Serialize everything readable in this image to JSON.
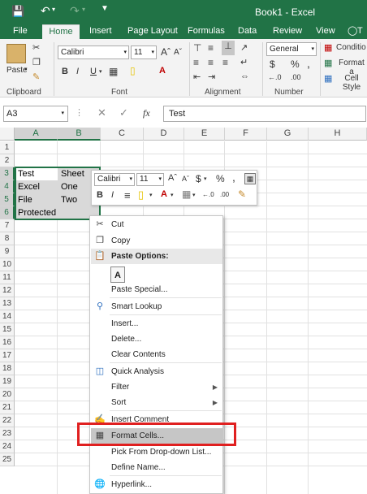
{
  "title_bar": {
    "title": "Book1 - Excel",
    "tell_me_partial": "T"
  },
  "ribbon_tabs": [
    "File",
    "Home",
    "Insert",
    "Page Layout",
    "Formulas",
    "Data",
    "Review",
    "View"
  ],
  "ribbon": {
    "paste_label": "Paste",
    "font_name": "Calibri",
    "font_size": "11",
    "number_format": "General",
    "bold": "B",
    "italic": "I",
    "underline": "U",
    "currency": "$",
    "percent": "%",
    "comma": ",",
    "conditional_formatting": "Conditio",
    "format_as_table": "Format a",
    "cell_styles": "Cell Style",
    "groups": {
      "clipboard": "Clipboard",
      "font": "Font",
      "alignment": "Alignment",
      "number": "Number"
    }
  },
  "formula_bar": {
    "name_box": "A3",
    "fx": "fx",
    "content": "Test"
  },
  "columns": [
    "A",
    "B",
    "C",
    "D",
    "E",
    "F",
    "G",
    "H"
  ],
  "rows": [
    "1",
    "2",
    "3",
    "4",
    "5",
    "6",
    "7",
    "8",
    "9",
    "10",
    "11",
    "12",
    "13",
    "14",
    "15",
    "16",
    "17",
    "18",
    "19",
    "20",
    "21",
    "22",
    "23",
    "24",
    "25"
  ],
  "cells": {
    "A3": "Test",
    "B3": "Sheet",
    "A4": "Excel",
    "B4": "One",
    "A5": "File",
    "B5": "Two",
    "A6": "Protected"
  },
  "mini_toolbar": {
    "font_name": "Calibri",
    "font_size": "11",
    "grow": "A˄",
    "shrink": "A˅",
    "currency": "$",
    "percent": "%",
    "comma": ",",
    "bold": "B",
    "italic": "I",
    "align": "≡",
    "increase_decimal": "←.0 .00",
    "decrease_decimal": ".00 →.0"
  },
  "context_menu": {
    "cut": "Cut",
    "copy": "Copy",
    "paste_options": "Paste Options:",
    "paste_special": "Paste Special...",
    "smart_lookup": "Smart Lookup",
    "insert": "Insert...",
    "delete": "Delete...",
    "clear_contents": "Clear Contents",
    "quick_analysis": "Quick Analysis",
    "filter": "Filter",
    "sort": "Sort",
    "insert_comment": "Insert Comment",
    "format_cells": "Format Cells...",
    "pick_from_list": "Pick From Drop-down List...",
    "define_name": "Define Name...",
    "hyperlink": "Hyperlink..."
  },
  "colors": {
    "excel_green": "#217346",
    "highlight_red": "#e02020",
    "selected_cell": "#d9d9d9"
  }
}
